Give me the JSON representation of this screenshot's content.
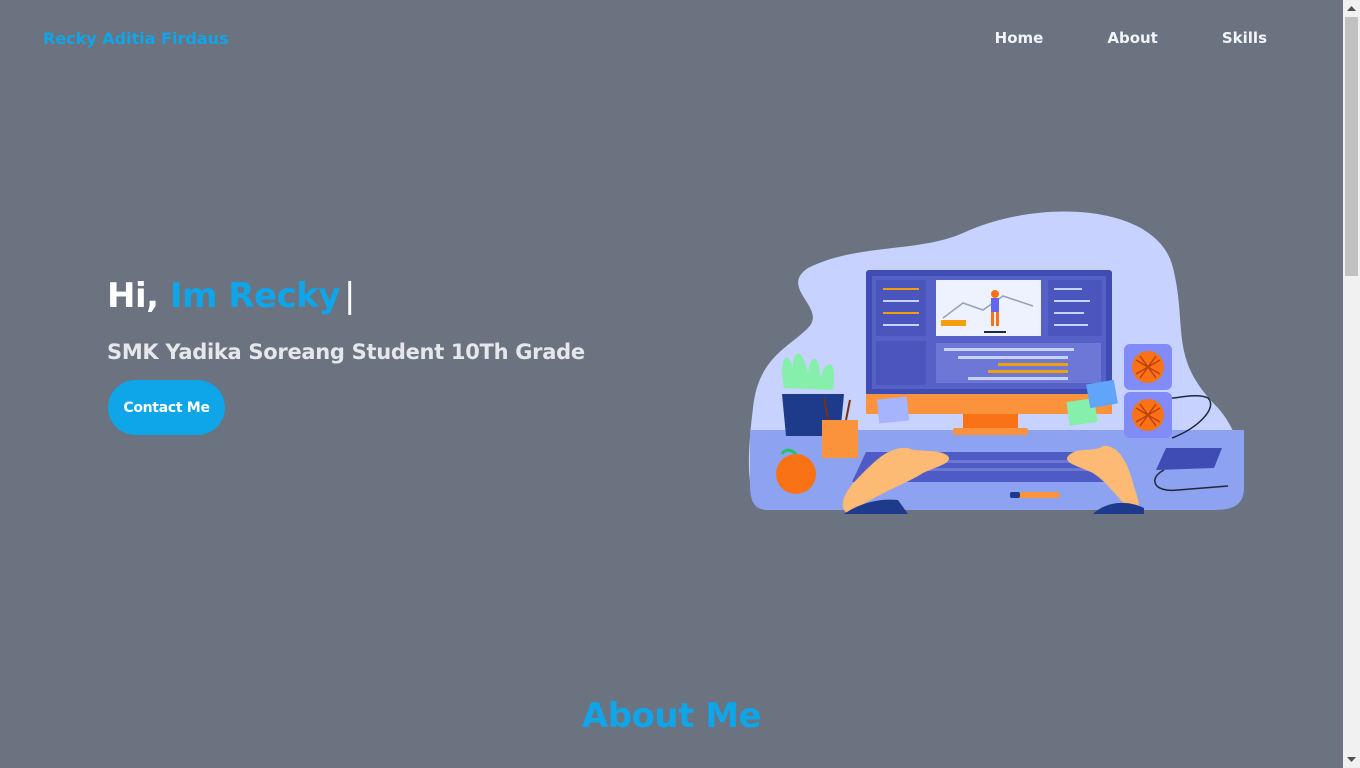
{
  "navbar": {
    "brand": "Recky Aditia Firdaus",
    "links": [
      {
        "label": "Home"
      },
      {
        "label": "About"
      },
      {
        "label": "Skills"
      }
    ]
  },
  "hero": {
    "greeting": "Hi,",
    "name": "Im Recky",
    "caret": "|",
    "subtitle": "SMK Yadika Soreang Student 10Th Grade",
    "cta_label": "Contact Me",
    "illustration": "developer-at-computer-illustration"
  },
  "about": {
    "title": "About Me"
  },
  "colors": {
    "background": "#6b7280",
    "accent": "#0ea5e9",
    "text": "#ffffff"
  },
  "scrollbar": {
    "icons": [
      "scroll-up-icon",
      "scroll-down-icon"
    ]
  }
}
